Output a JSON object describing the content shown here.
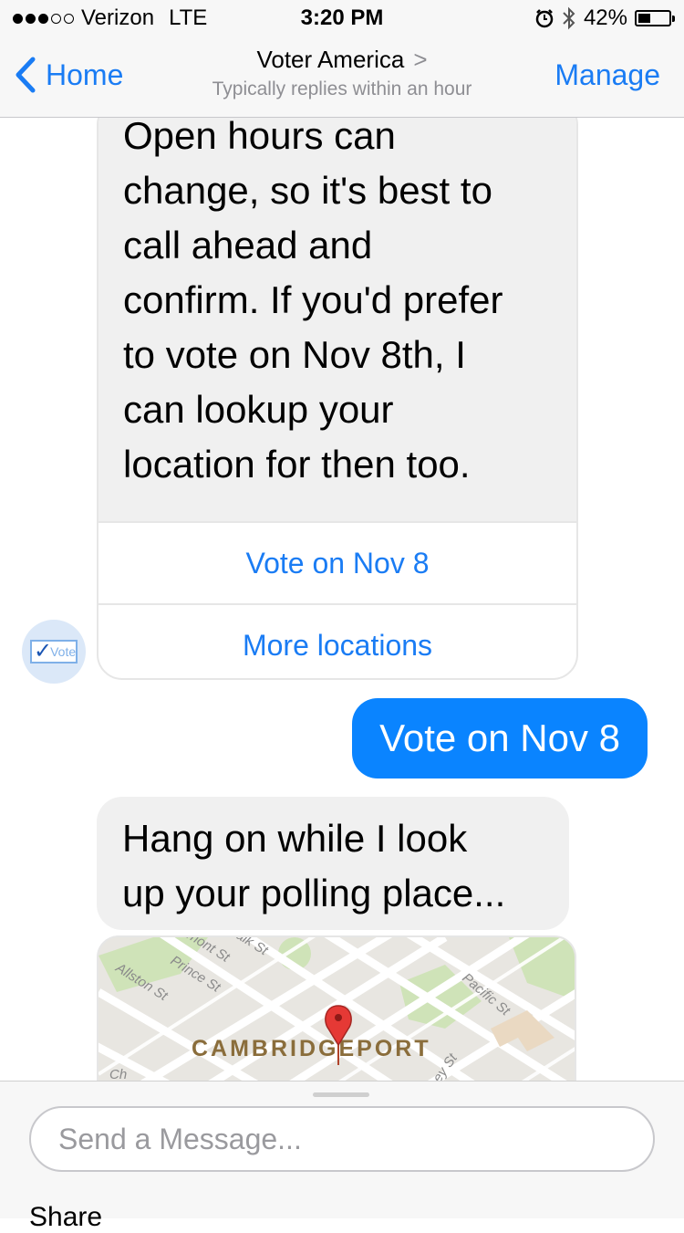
{
  "status_bar": {
    "carrier": "Verizon",
    "network": "LTE",
    "time": "3:20 PM",
    "battery": "42%",
    "battery_level": 0.42
  },
  "nav": {
    "back_label": "Home",
    "title": "Voter America",
    "subtitle": "Typically replies within an hour",
    "manage_label": "Manage"
  },
  "messages": {
    "card_text": "Open hours can\nchange, so it's best to\ncall ahead and\nconfirm.  If you'd prefer\nto vote on Nov 8th, I\ncan lookup your\nlocation for then too.",
    "card_buttons": [
      "Vote on Nov 8",
      "More locations"
    ],
    "avatar_label": "Vote",
    "outgoing": "Vote on Nov 8",
    "incoming": "Hang on while I look\nup your polling place..."
  },
  "map": {
    "area_label": "CAMBRIDGEPORT",
    "streets": [
      "Allston St",
      "Prince St",
      "Pacific St",
      "mont St",
      "alk St",
      "ey St",
      "Ch"
    ]
  },
  "composer": {
    "placeholder": "Send a Message...",
    "share_label": "Share"
  },
  "colors": {
    "accent": "#1a7cf4",
    "outgoing_bubble": "#0a84ff",
    "incoming_bubble": "#f0f0f0"
  }
}
